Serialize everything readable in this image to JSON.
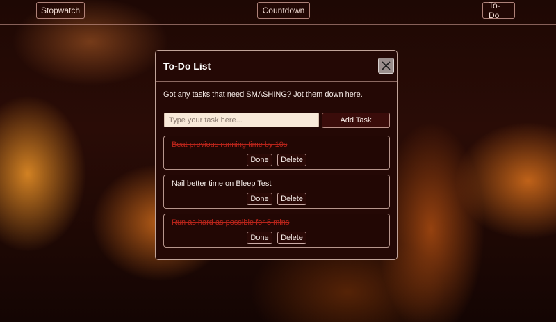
{
  "nav": {
    "stopwatch": "Stopwatch",
    "countdown": "Countdown",
    "todo": "To-Do"
  },
  "modal": {
    "title": "To-Do List",
    "close_icon": "close-icon",
    "intro": "Got any tasks that need SMASHING? Jot them down here.",
    "input_placeholder": "Type your task here...",
    "input_value": "",
    "add_label": "Add Task"
  },
  "tasks": [
    {
      "text": "Beat previous running time by 10s",
      "completed": true,
      "done_label": "Done",
      "delete_label": "Delete"
    },
    {
      "text": "Nail better time on Bleep Test",
      "completed": false,
      "done_label": "Done",
      "delete_label": "Delete"
    },
    {
      "text": "Run as hard as possible for 5 mins",
      "completed": true,
      "done_label": "Done",
      "delete_label": "Delete"
    }
  ],
  "colors": {
    "completed_task": "#b8241a",
    "modal_bg": "#240805",
    "input_bg": "#f8e9d9"
  }
}
